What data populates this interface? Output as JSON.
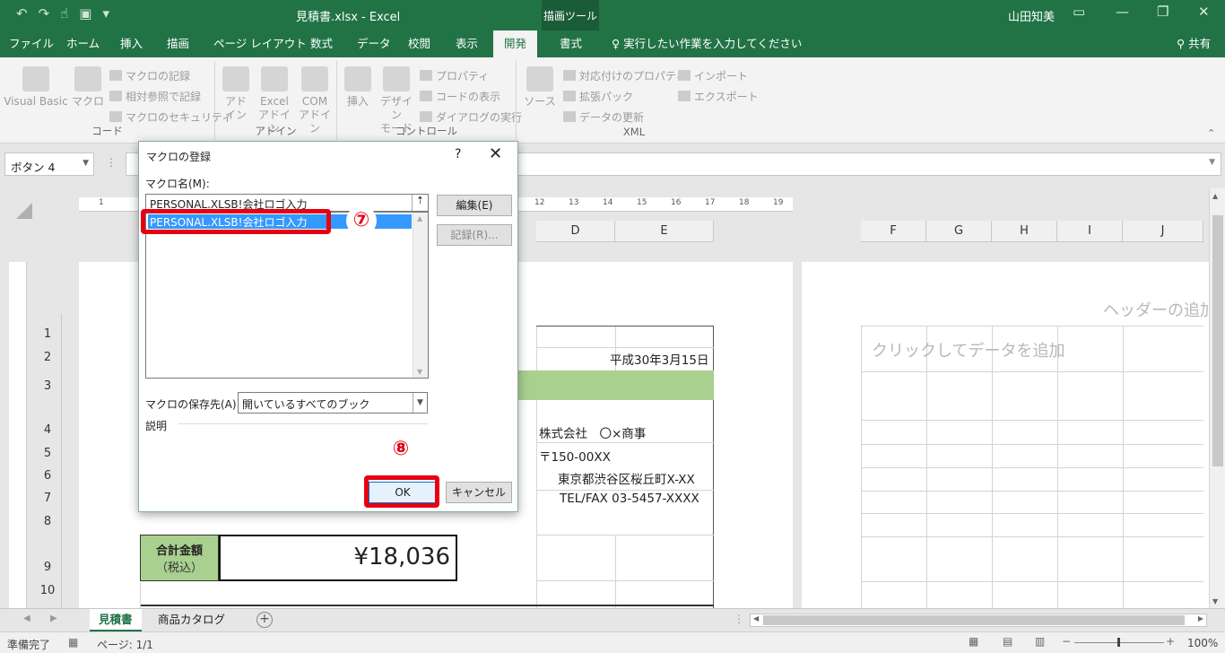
{
  "titlebar": {
    "filename_title": "見積書.xlsx  -  Excel",
    "context_tab": "描画ツール",
    "user": "山田知美",
    "qat_icons": [
      "undo-icon",
      "redo-icon",
      "touch-mode-icon",
      "save-icon",
      "customize-icon"
    ]
  },
  "tabs": [
    {
      "label": "ファイル"
    },
    {
      "label": "ホーム"
    },
    {
      "label": "挿入"
    },
    {
      "label": "描画"
    },
    {
      "label": "ページ レイアウト"
    },
    {
      "label": "数式"
    },
    {
      "label": "データ"
    },
    {
      "label": "校閲"
    },
    {
      "label": "表示"
    },
    {
      "label": "開発"
    },
    {
      "label": "書式"
    }
  ],
  "tell_me": "♀ 実行したい作業を入力してください",
  "share": "共有",
  "ribbon": {
    "code": {
      "name": "コード",
      "visual_basic": "Visual Basic",
      "macro": "マクロ",
      "record_macro": "マクロの記録",
      "relative_ref": "相対参照で記録",
      "macro_security": "マクロのセキュリティ"
    },
    "addins": {
      "name": "アドイン",
      "addin_1": "アド",
      "addin_2": "イン",
      "excel_addin_1": "Excel",
      "excel_addin_2": "アドイン",
      "com_addin_1": "COM",
      "com_addin_2": "アドイン"
    },
    "controls": {
      "name": "コントロール",
      "insert": "挿入",
      "design_1": "デザイン",
      "design_2": "モード",
      "properties": "プロパティ",
      "view_code": "コードの表示",
      "run_dialog": "ダイアログの実行"
    },
    "xml": {
      "name": "XML",
      "source": "ソース",
      "map_properties": "対応付けのプロパティ",
      "expansion_packs": "拡張パック",
      "refresh_data": "データの更新",
      "import": "インポート",
      "export": "エクスポート"
    }
  },
  "namebox": "ボタン 4",
  "ruler_numbers": [
    "1",
    "12",
    "13",
    "14",
    "15",
    "16",
    "17",
    "18",
    "19"
  ],
  "columns_left": [
    "D",
    "E"
  ],
  "columns_right": [
    "F",
    "G",
    "H",
    "I",
    "J"
  ],
  "rows": [
    "1",
    "2",
    "3",
    "4",
    "5",
    "6",
    "7",
    "8",
    "9",
    "10"
  ],
  "sheet": {
    "date": "平成30年3月15日",
    "company": "株式会社　〇×商事",
    "postal": "〒150-00XX",
    "address": "東京都渋谷区桜丘町X-XX",
    "tel": "TEL/FAX 03-5457-XXXX",
    "total_label_1": "合計金額",
    "total_label_2": "（税込）",
    "total_value": "¥18,036",
    "header_placeholder": "ヘッダーの追加",
    "data_placeholder": "クリックしてデータを追加"
  },
  "dialog": {
    "title": "マクロの登録",
    "help": "?",
    "close": "✕",
    "macro_name_label": "マクロ名(M):",
    "macro_name_value": "PERSONAL.XLSB!会社ロゴ入力",
    "list_items": [
      "PERSONAL.XLSB!会社ロゴ入力"
    ],
    "edit_button": "編集(E)",
    "record_button": "記録(R)...",
    "macro_location_label": "マクロの保存先(A):",
    "macro_location_value": "開いているすべてのブック",
    "description_label": "説明",
    "ok_button": "OK",
    "cancel_button": "キャンセル"
  },
  "annotations": {
    "step7": "⑦",
    "step8": "⑧",
    "highlight_color": "#e60012"
  },
  "sheet_tabs": [
    {
      "label": "見積書",
      "active": true
    },
    {
      "label": "商品カタログ",
      "active": false
    }
  ],
  "status": {
    "ready": "準備完了",
    "page": "ページ: 1/1",
    "zoom": "100%"
  },
  "colors": {
    "excel_green": "#217346",
    "cell_green": "#a9d08e",
    "selection_blue": "#3399ff"
  }
}
